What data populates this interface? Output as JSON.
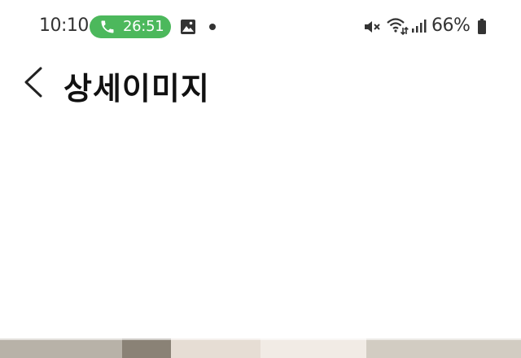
{
  "status_bar": {
    "time": "10:10",
    "call_duration": "26:51",
    "battery": "66%",
    "colors": {
      "call_pill": "#4cb85c"
    },
    "icons": [
      "phone-icon",
      "gallery-icon",
      "mute-icon",
      "wifi-icon",
      "signal-icon",
      "battery-icon"
    ]
  },
  "header": {
    "title": "상세이미지",
    "back_icon": "chevron-left-icon"
  }
}
